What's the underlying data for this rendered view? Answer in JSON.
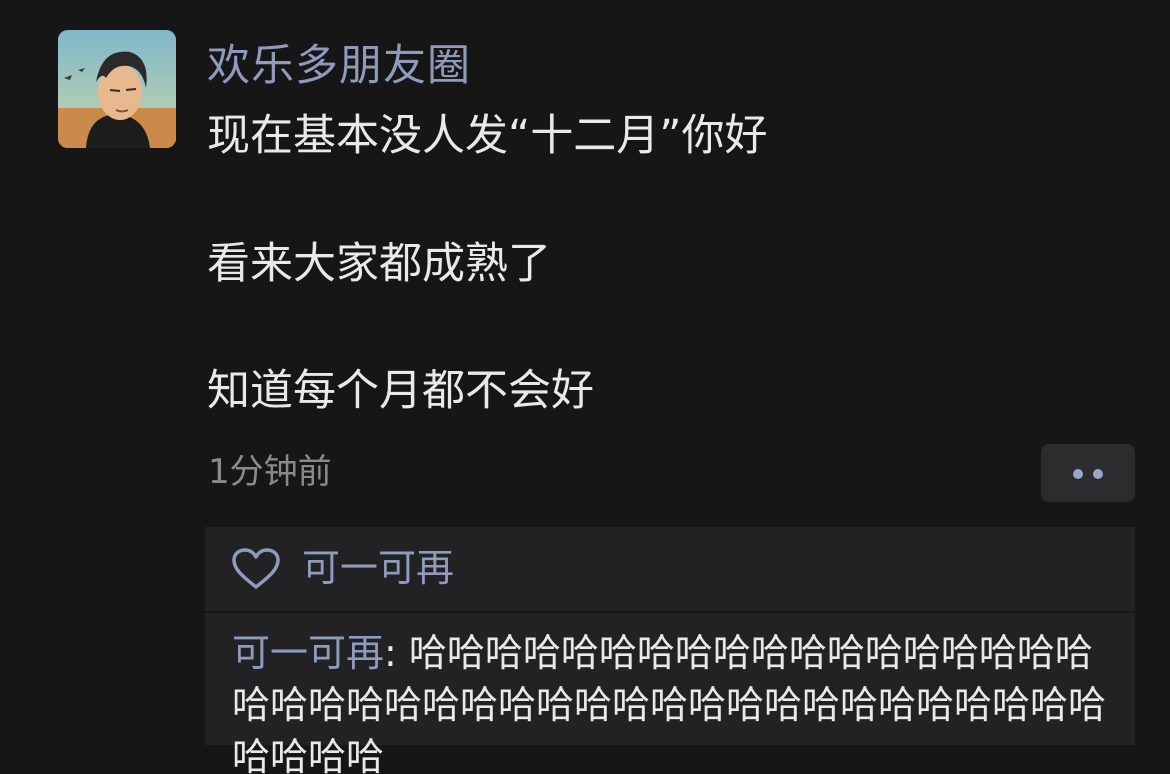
{
  "post": {
    "author": "欢乐多朋友圈",
    "lines": [
      "现在基本没人发“十二月”你好",
      "看来大家都成熟了",
      "知道每个月都不会好"
    ],
    "timestamp": "1分钟前"
  },
  "interactions": {
    "likes": {
      "icon": "heart-icon",
      "names": "可一可再"
    },
    "comments": [
      {
        "author": "可一可再",
        "separator": ": ",
        "text": "哈哈哈哈哈哈哈哈哈哈哈哈哈哈哈哈哈哈哈哈哈哈哈哈哈哈哈哈哈哈哈哈哈哈哈哈哈哈哈哈哈哈哈哈哈"
      }
    ]
  },
  "colors": {
    "background": "#161616",
    "name_link": "#8f9bbd",
    "body_text": "#e9e9e9",
    "timestamp": "#8a8a8a",
    "panel": "#222224"
  }
}
